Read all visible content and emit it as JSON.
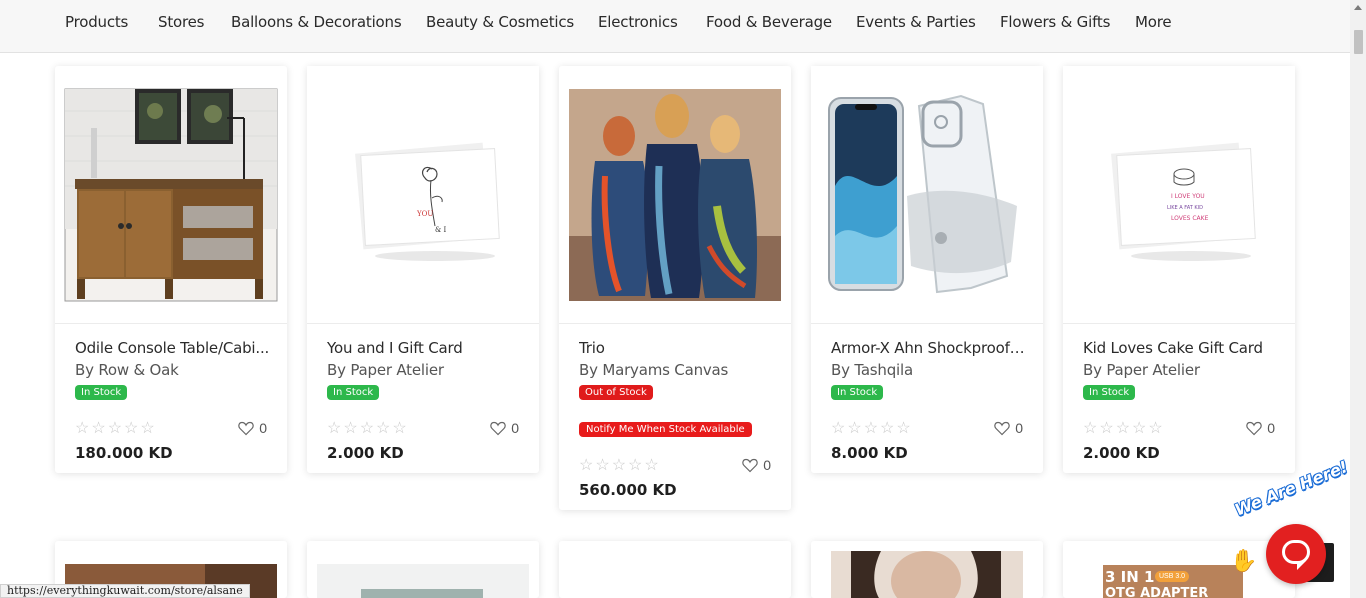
{
  "nav": {
    "items": [
      "Products",
      "Stores",
      "Balloons & Decorations",
      "Beauty & Cosmetics",
      "Electronics",
      "Food & Beverage",
      "Events & Parties",
      "Flowers & Gifts",
      "More"
    ]
  },
  "products": [
    {
      "title": "Odile Console Table/Cabi...",
      "brand": "By Row & Oak",
      "stock": "In Stock",
      "likes": "0",
      "price": "180.000 KD",
      "rating_stars": 0
    },
    {
      "title": "You and I Gift Card",
      "brand": "By Paper Atelier",
      "stock": "In Stock",
      "likes": "0",
      "price": "2.000 KD",
      "rating_stars": 0
    },
    {
      "title": "Trio",
      "brand": "By Maryams Canvas",
      "stock": "Out of Stock",
      "notify": "Notify Me When Stock Available",
      "likes": "0",
      "price": "560.000 KD",
      "rating_stars": 0
    },
    {
      "title": "Armor-X Ahn Shockproof ...",
      "brand": "By Tashqila",
      "stock": "In Stock",
      "likes": "0",
      "price": "8.000 KD",
      "rating_stars": 0
    },
    {
      "title": "Kid Loves Cake Gift Card",
      "brand": "By Paper Atelier",
      "stock": "In Stock",
      "likes": "0",
      "price": "2.000 KD",
      "rating_stars": 0
    }
  ],
  "gift_card_texts": {
    "you_and_i_left": "YOU",
    "you_and_i_right": "& I",
    "kid_cake_line1": "I LOVE YOU",
    "kid_cake_line2": "LIKE A FAT KID",
    "kid_cake_line3": "LOVES CAKE"
  },
  "otg_card": {
    "line1": "3 IN 1",
    "badge": "USB 3.0",
    "line2": "OTG ADAPTER"
  },
  "statusbar": {
    "url": "https://everythingkuwait.com/store/alsane"
  },
  "chat": {
    "tagline": "We Are Here!"
  },
  "colors": {
    "in_stock": "#2db84b",
    "out_of_stock": "#e01b1b",
    "chat": "#e22020",
    "star_empty": "#c9c9c9"
  }
}
